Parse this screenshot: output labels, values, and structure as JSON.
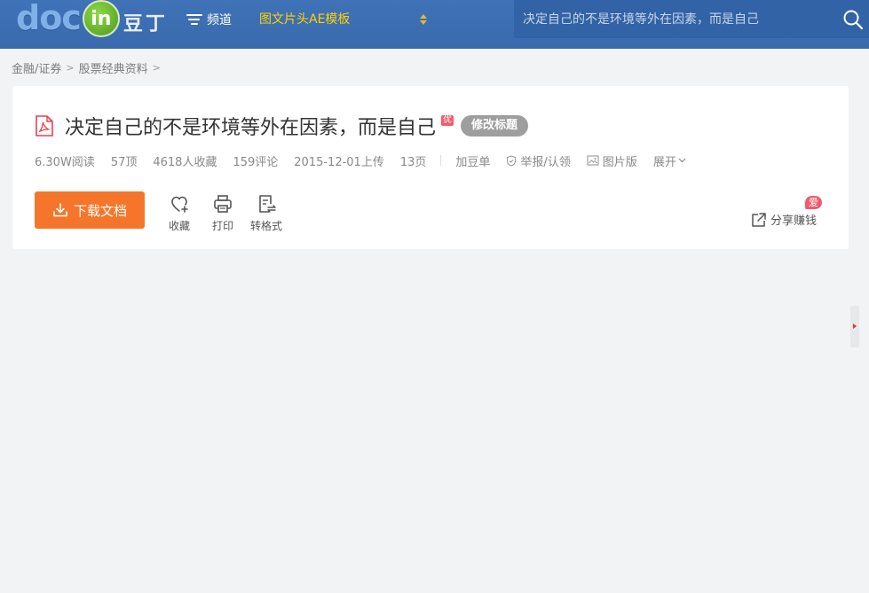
{
  "header": {
    "logo_text": "doc",
    "logo_in": "in",
    "logo_cn": "豆丁",
    "channel_label": "频道",
    "promo_label": "图文片头AE模板",
    "search_placeholder": "决定自己的不是环境等外在因素，而是自己"
  },
  "breadcrumb": {
    "items": [
      "金融/证券",
      "股票经典资料"
    ],
    "separator": ">"
  },
  "document": {
    "title": "决定自己的不是环境等外在因素，而是自己",
    "quality_badge": "优",
    "edit_title_label": "修改标题",
    "meta": {
      "reads": "6.30W阅读",
      "likes": "57顶",
      "favorites": "4618人收藏",
      "comments": "159评论",
      "upload_date": "2015-12-01上传",
      "pages": "13页"
    },
    "actions": {
      "add_to_list": "加豆单",
      "report": "举报/认领",
      "image_version": "图片版",
      "expand": "展开"
    }
  },
  "toolbar": {
    "download_label": "下载文档",
    "favorite_label": "收藏",
    "print_label": "打印",
    "convert_label": "转格式",
    "share_label": "分享赚钱",
    "share_badge": "爱"
  },
  "colors": {
    "header_bg": "#3c6fb4",
    "promo": "#ffd200",
    "download_bg": "#f5762a",
    "badge": "#f05d6b"
  }
}
